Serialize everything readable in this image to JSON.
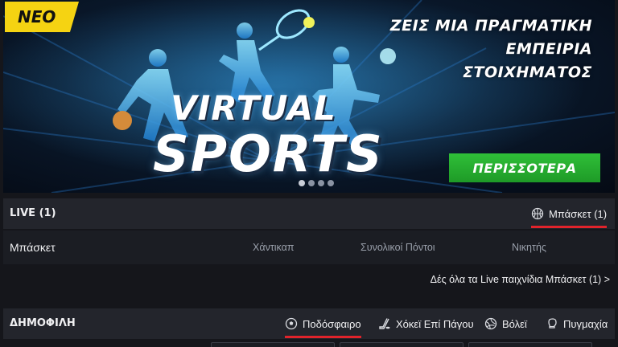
{
  "banner": {
    "badge": "NEO",
    "headline_lines": [
      "ΖΕΙΣ ΜΙΑ ΠΡΑΓΜΑΤΙΚΗ",
      "ΕΜΠΕΙΡΙΑ",
      "ΣΤΟΙΧΗΜΑΤΟΣ"
    ],
    "logo_line1": "VIRTUAL",
    "logo_line2": "SPORTS",
    "cta_label": "ΠΕΡΙΣΣΟΤΕΡΑ",
    "slide_count": 4,
    "active_slide": 1,
    "accent_green": "#24ad2d",
    "badge_color": "#f5d312"
  },
  "live": {
    "title": "LIVE (1)",
    "tab": {
      "label": "Μπάσκετ (1)",
      "icon": "basketball-icon",
      "active": true
    },
    "sport_name": "Μπάσκετ",
    "columns": [
      "Χάντικαπ",
      "Συνολικοί Πόντοι",
      "Νικητής"
    ],
    "see_all": "Δές όλα τα Live παιχνίδια Μπάσκετ (1) >"
  },
  "popular": {
    "title": "ΔΗΜΟΦΙΛΗ",
    "tabs": [
      {
        "label": "Ποδόσφαιρο",
        "icon": "soccer-ball-icon",
        "active": true
      },
      {
        "label": "Χόκεϊ Επί Πάγου",
        "icon": "ice-hockey-icon",
        "active": false
      },
      {
        "label": "Βόλεϊ",
        "icon": "volleyball-icon",
        "active": false
      },
      {
        "label": "Πυγμαχία",
        "icon": "boxing-glove-icon",
        "active": false
      }
    ]
  },
  "accent_red": "#e0232b"
}
